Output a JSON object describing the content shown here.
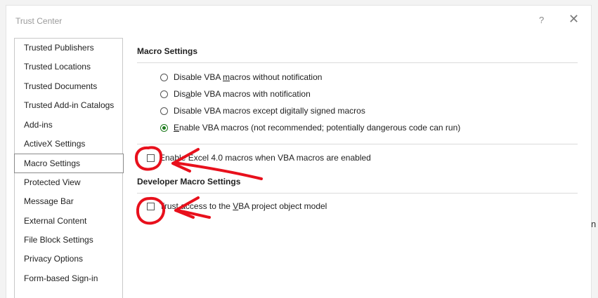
{
  "window": {
    "title": "Trust Center",
    "help_label": "?",
    "close_label": "✕"
  },
  "sidebar": {
    "items": [
      {
        "label": "Trusted Publishers"
      },
      {
        "label": "Trusted Locations"
      },
      {
        "label": "Trusted Documents"
      },
      {
        "label": "Trusted Add-in Catalogs"
      },
      {
        "label": "Add-ins"
      },
      {
        "label": "ActiveX Settings"
      },
      {
        "label": "Macro Settings",
        "selected": true
      },
      {
        "label": "Protected View"
      },
      {
        "label": "Message Bar"
      },
      {
        "label": "External Content"
      },
      {
        "label": "File Block Settings"
      },
      {
        "label": "Privacy Options"
      },
      {
        "label": "Form-based Sign-in"
      }
    ]
  },
  "macro_settings": {
    "title": "Macro Settings",
    "options": [
      {
        "pre": "Disable VBA ",
        "u": "m",
        "post": "acros without notification",
        "checked": false
      },
      {
        "pre": "Dis",
        "u": "a",
        "post": "ble VBA macros with notification",
        "checked": false
      },
      {
        "pre": "Disable VBA macros except di",
        "u": "g",
        "post": "itally signed macros",
        "checked": false
      },
      {
        "pre": "",
        "u": "E",
        "post": "nable VBA macros (not recommended; potentially dangerous code can run)",
        "checked": true
      }
    ],
    "excel4": {
      "pre": "Enable ",
      "u": "",
      "post": "Excel 4.0 macros when VBA macros are enabled",
      "checked": false
    }
  },
  "developer": {
    "title": "Developer Macro Settings",
    "trust_vba": {
      "pre": "Trust access to the ",
      "u": "V",
      "post": "BA project object model",
      "checked": false
    }
  },
  "edge_glyph": "n",
  "colors": {
    "annotation_red": "#e8101c",
    "radio_selected": "#1e7b1e"
  }
}
